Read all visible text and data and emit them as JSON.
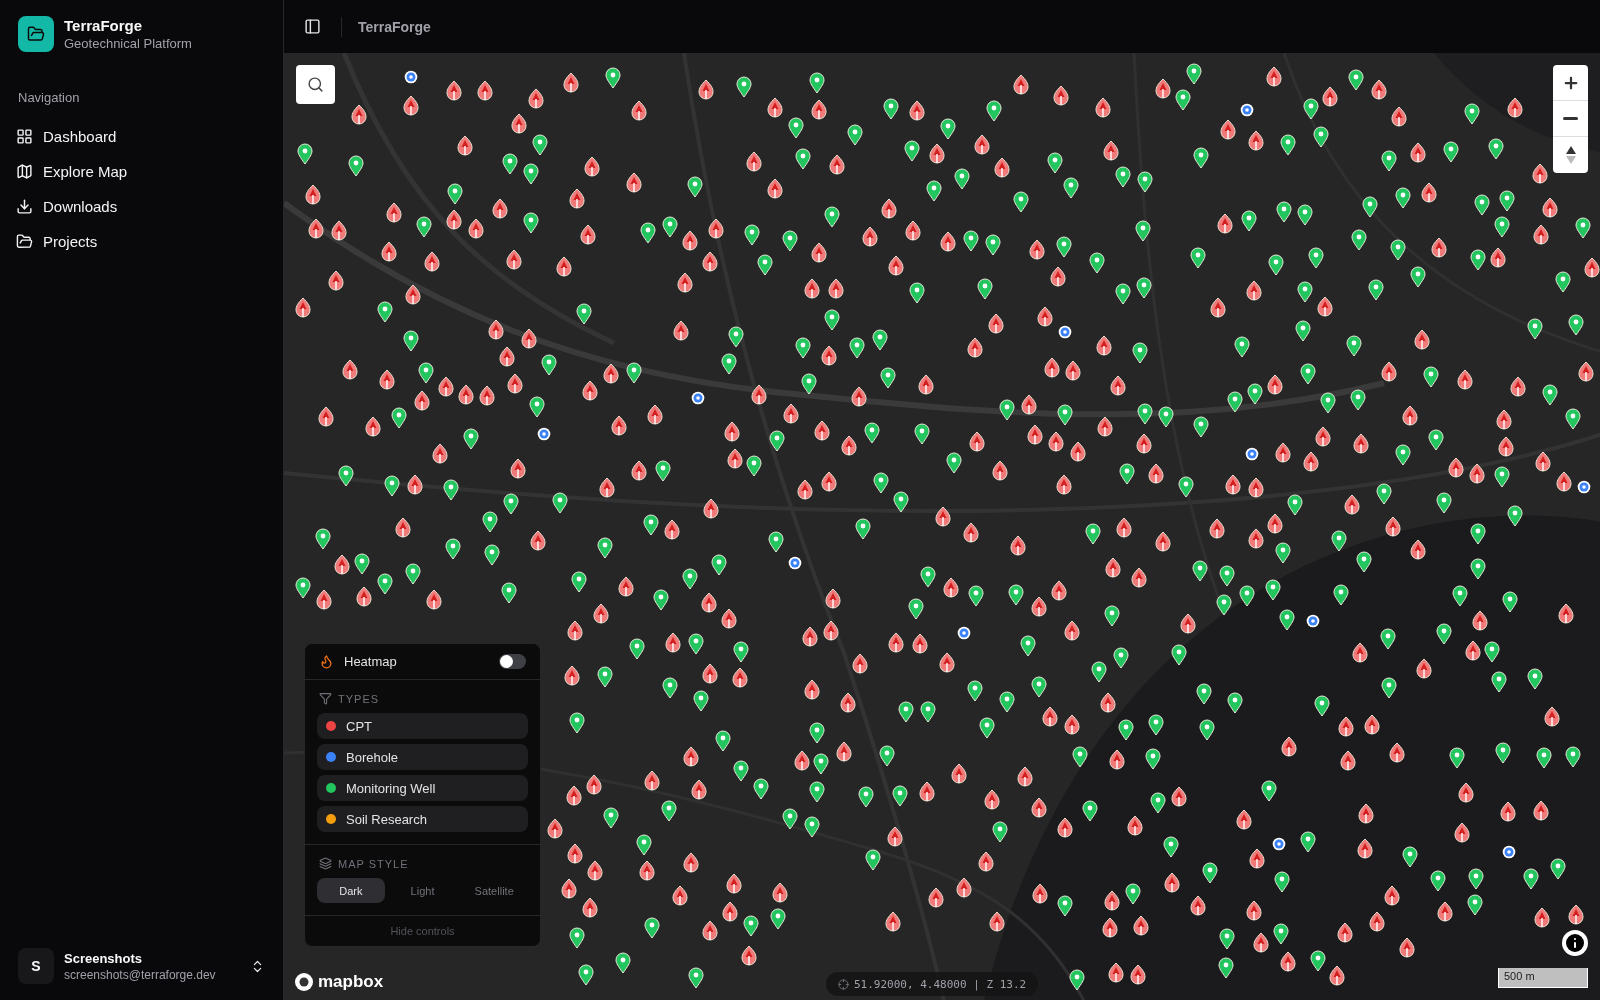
{
  "sidebar": {
    "brand": {
      "title": "TerraForge",
      "subtitle": "Geotechnical Platform"
    },
    "section_label": "Navigation",
    "items": [
      {
        "label": "Dashboard",
        "kind": "dashboard"
      },
      {
        "label": "Explore Map",
        "kind": "map"
      },
      {
        "label": "Downloads",
        "kind": "download"
      },
      {
        "label": "Projects",
        "kind": "folder"
      }
    ],
    "user": {
      "avatar": "S",
      "name": "Screenshots",
      "email": "screenshots@terraforge.dev"
    }
  },
  "topbar": {
    "title": "TerraForge"
  },
  "map": {
    "controls": {
      "heatmap": {
        "label": "Heatmap",
        "on": false
      },
      "types_label": "TYPES",
      "types": [
        {
          "label": "CPT",
          "color": "#ef4444"
        },
        {
          "label": "Borehole",
          "color": "#3b82f6"
        },
        {
          "label": "Monitoring Well",
          "color": "#22c55e"
        },
        {
          "label": "Soil Research",
          "color": "#f59e0b"
        }
      ],
      "style_label": "MAP STYLE",
      "styles": [
        {
          "label": "Dark",
          "selected": true
        },
        {
          "label": "Light",
          "selected": false
        },
        {
          "label": "Satellite",
          "selected": false
        }
      ],
      "hide_label": "Hide controls"
    },
    "attribution": "mapbox",
    "coordinates": "51.92000, 4.48000 | Z 13.2",
    "scale": "500 m"
  }
}
